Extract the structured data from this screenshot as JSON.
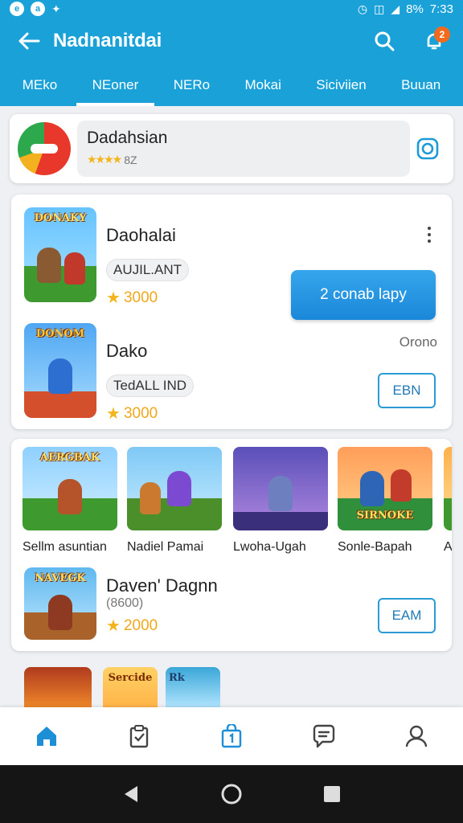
{
  "status_bar": {
    "battery": "8%",
    "time": "7:33"
  },
  "app_bar": {
    "title": "Nadnanitdai",
    "notification_count": "2"
  },
  "tabs": [
    {
      "label": "MEko",
      "active": false
    },
    {
      "label": "NEoner",
      "active": true
    },
    {
      "label": "NERo",
      "active": false
    },
    {
      "label": "Mokai",
      "active": false
    },
    {
      "label": "Siciviien",
      "active": false
    },
    {
      "label": "Buuan",
      "active": false
    }
  ],
  "search_card": {
    "name": "Dadahsian",
    "rating": "8Z"
  },
  "card1": {
    "item1": {
      "name": "Daohalai",
      "tag": "AUJIL.ANT",
      "rating": "3000",
      "button": "2 conab lapy"
    },
    "item2": {
      "name": "Dako",
      "tag": "TedALL IND",
      "rating": "3000",
      "meta": "Orono",
      "button": "EBN"
    }
  },
  "card2": {
    "tiles": [
      {
        "label": "Sellm asuntian",
        "art_title": "AERGBAK"
      },
      {
        "label": "Nadiel Pamai",
        "art_title": ""
      },
      {
        "label": "Lwoha-Ugah",
        "art_title": ""
      },
      {
        "label": "Sonle-Bapah",
        "art_title": "SIRNOKE"
      },
      {
        "label": "A",
        "art_title": ""
      }
    ],
    "item": {
      "name": "Daven' Dagnn",
      "sub": "(8600)",
      "rating": "2000",
      "button": "EAM"
    }
  },
  "thumbs": {
    "item1_title": "DONAKY",
    "item2_title": "DONOM",
    "item3_title": "NAVEGK"
  },
  "peek_tiles": [
    {
      "title": ""
    },
    {
      "title": "Sercide"
    },
    {
      "title": "Rk"
    }
  ],
  "colors": {
    "primary": "#1aa2d8",
    "accent_orange": "#f26a1b",
    "star": "#f2b51c"
  }
}
